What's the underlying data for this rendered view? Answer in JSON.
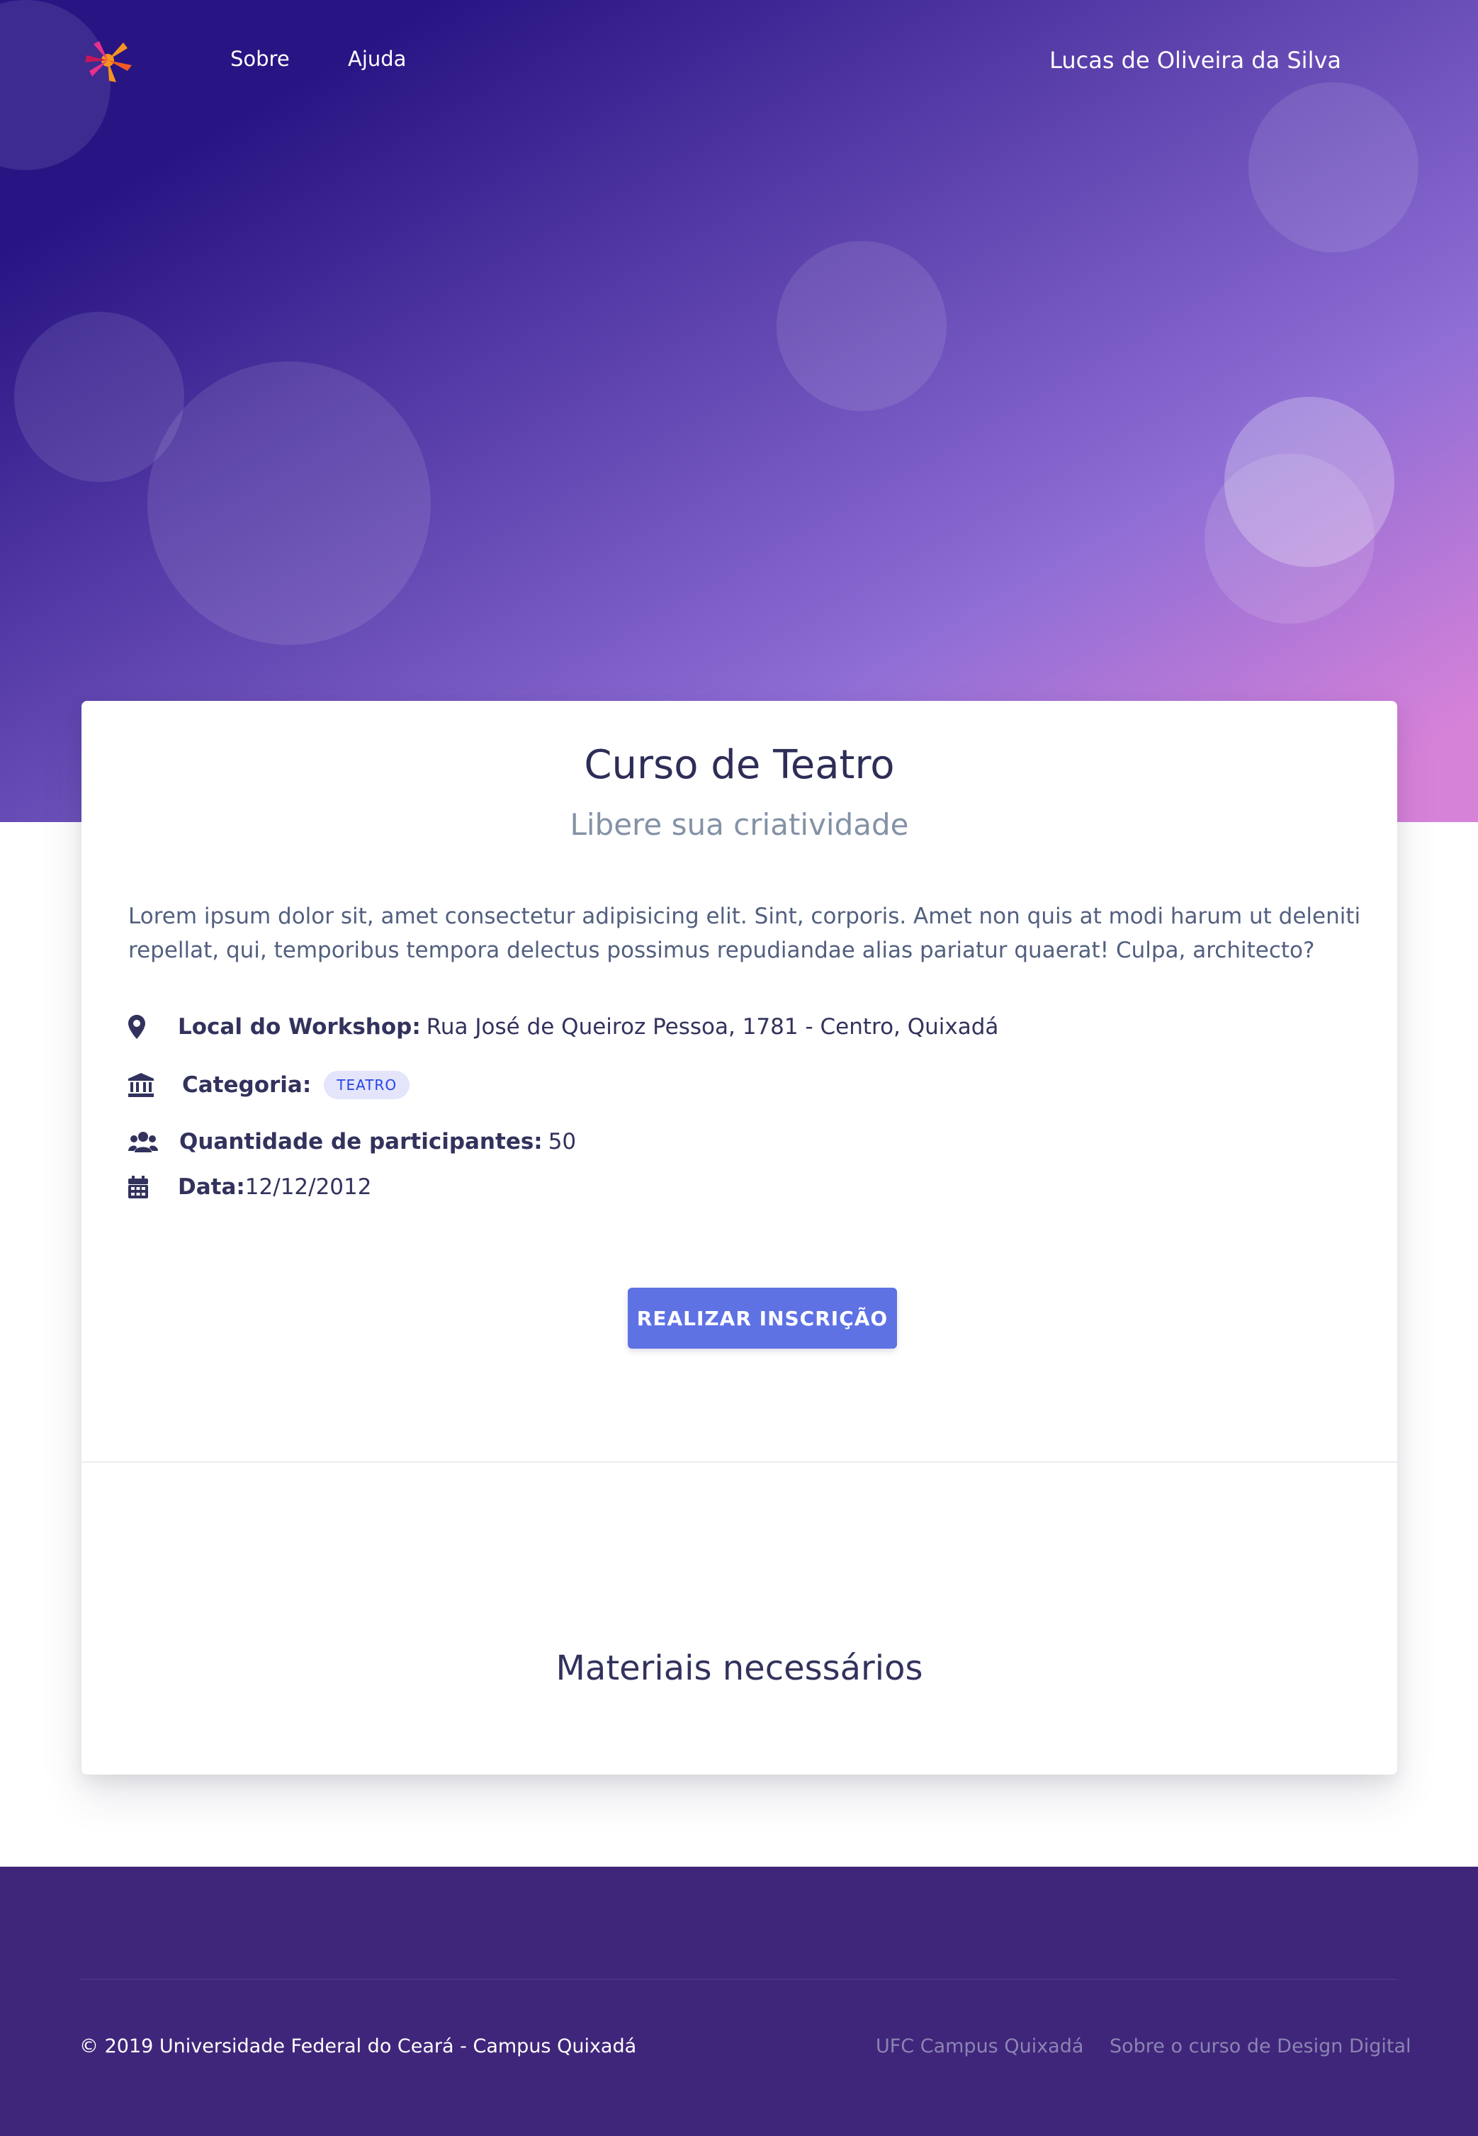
{
  "nav": {
    "links": [
      "Sobre",
      "Ajuda"
    ],
    "user_name": "Lucas de Oliveira da Silva"
  },
  "workshop": {
    "title": "Curso de Teatro",
    "subtitle": "Libere sua criatividade",
    "description": "Lorem ipsum dolor sit, amet consectetur adipisicing elit. Sint, corporis. Amet non quis at modi harum ut deleniti repellat, qui, temporibus tempora delectus possimus repudiandae alias pariatur quaerat! Culpa, architecto?",
    "location_label": "Local do Workshop:",
    "location_value": "Rua José de Queiroz Pessoa, 1781 - Centro, Quixadá",
    "category_label": "Categoria:",
    "category_badge": "TEATRO",
    "participants_label": "Quantidade de participantes:",
    "participants_value": "50",
    "date_label": "Data:",
    "date_value": "12/12/2012",
    "register_button": "REALIZAR INSCRIÇÃO",
    "materials_title": "Materiais necessários"
  },
  "footer": {
    "copyright": "© 2019 Universidade Federal do Ceará - Campus Quixadá",
    "links": [
      "UFC Campus Quixadá",
      "Sobre o curso de Design Digital"
    ]
  },
  "colors": {
    "primary_button": "#5e72e4",
    "footer_bg": "#3f267a",
    "hero_gradient_start": "#281483",
    "hero_gradient_end": "#d782d9"
  },
  "icons": [
    "map-pin-icon",
    "institution-icon",
    "users-icon",
    "calendar-icon",
    "logo-icon"
  ]
}
